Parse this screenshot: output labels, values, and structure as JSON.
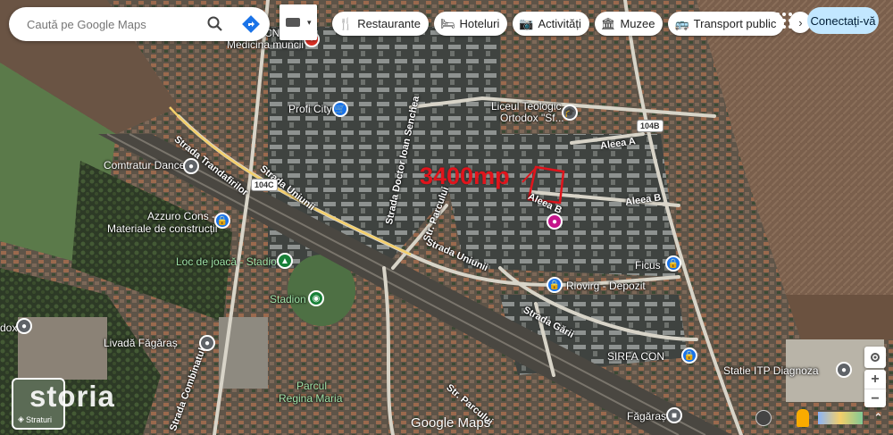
{
  "search": {
    "placeholder": "Caută pe Google Maps"
  },
  "chips": [
    {
      "label": "Restaurante",
      "icon": "fork-knife-icon"
    },
    {
      "label": "Hoteluri",
      "icon": "bed-icon"
    },
    {
      "label": "Activități",
      "icon": "camera-icon"
    },
    {
      "label": "Muzee",
      "icon": "museum-icon"
    },
    {
      "label": "Transport public",
      "icon": "bus-icon"
    }
  ],
  "connect_label": "Conectați-vă",
  "annotation": {
    "area_label": "3400mp",
    "color": "#e0141c"
  },
  "places": {
    "medicina": "Medicina muncii",
    "profi": "Profi City",
    "liceu_1": "Liceul Teologic",
    "liceu_2": "Ortodox \"Sf...",
    "comtratur": "Comtratur Dance",
    "azzuro_1": "Azzuro Cons -",
    "azzuro_2": "Materiale de construcții",
    "loc_joaca": "Loc de joacă - Stadion",
    "stadion": "Stadion",
    "ficus": "Ficus",
    "riovirg": "Riovirg - Depozit",
    "sirfa": "SIRFA CON",
    "statie_itp": "Statie ITP Diagnoza",
    "livada": "Livadă Făgăraș",
    "parc_1": "Parcul",
    "parc_2": "Regina Maria",
    "fagaras": "Făgăraș",
    "dox": "dox"
  },
  "roads": {
    "trandafirilor": "Strada Trandafirilor",
    "unirii_1": "Strada Uniunii",
    "unirii_2": "Strada Uniunii",
    "doctor": "Strada Doctor Ioan Senchea",
    "parcului": "Str. Parcului",
    "parcului_2": "Str. Parcului",
    "aleea_a": "Aleea A",
    "aleea_b_1": "Aleea B",
    "aleea_b_2": "Aleea B",
    "garii": "Strada Gării",
    "combinatului": "Strada Combinatului",
    "shield_104c": "104C",
    "shield_104b": "104B",
    "cnn": "CNN"
  },
  "layers_label": "Straturi",
  "watermark": "storia",
  "logo": "Google Maps",
  "colors": {
    "connect_bg": "#c2e7ff",
    "poi_blue": "#1a73e8",
    "poi_green": "#188038",
    "poi_grey": "#5f6368",
    "poi_pink": "#c5158b"
  }
}
